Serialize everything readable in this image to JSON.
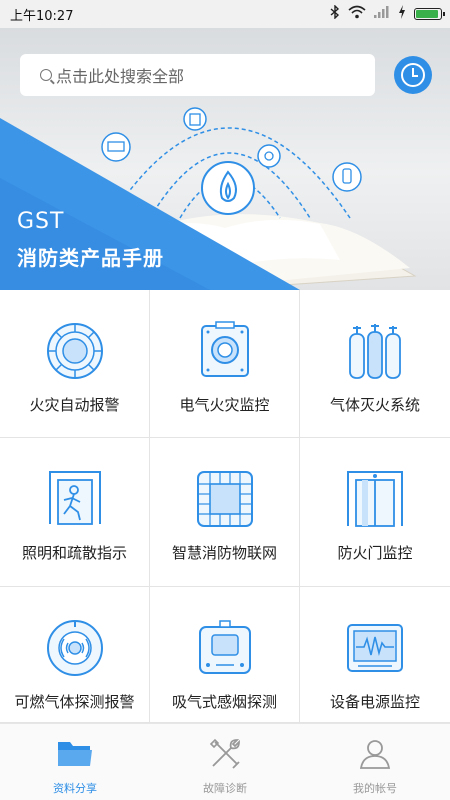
{
  "status_bar": {
    "time": "上午10:27"
  },
  "search": {
    "placeholder": "点击此处搜索全部"
  },
  "banner": {
    "brand": "GST",
    "subtitle": "消防类产品手册"
  },
  "categories": [
    {
      "label": "火灾自动报警",
      "icon": "fire-alarm-detector-icon"
    },
    {
      "label": "电气火灾监控",
      "icon": "electrical-fire-monitor-icon"
    },
    {
      "label": "气体灭火系统",
      "icon": "gas-cylinders-icon"
    },
    {
      "label": "照明和疏散指示",
      "icon": "emergency-exit-icon"
    },
    {
      "label": "智慧消防物联网",
      "icon": "iot-chip-icon"
    },
    {
      "label": "防火门监控",
      "icon": "fire-door-icon"
    },
    {
      "label": "可燃气体探测报警",
      "icon": "gas-detector-icon"
    },
    {
      "label": "吸气式感烟探测",
      "icon": "aspirating-smoke-detector-icon"
    },
    {
      "label": "设备电源监控",
      "icon": "power-monitor-icon"
    }
  ],
  "tabs": [
    {
      "label": "资料分享",
      "icon": "folder-icon",
      "active": true
    },
    {
      "label": "故障诊断",
      "icon": "tools-icon",
      "active": false
    },
    {
      "label": "我的帐号",
      "icon": "user-icon",
      "active": false
    }
  ],
  "colors": {
    "accent": "#2f8fe6",
    "banner_blue": "#3d95e8"
  }
}
